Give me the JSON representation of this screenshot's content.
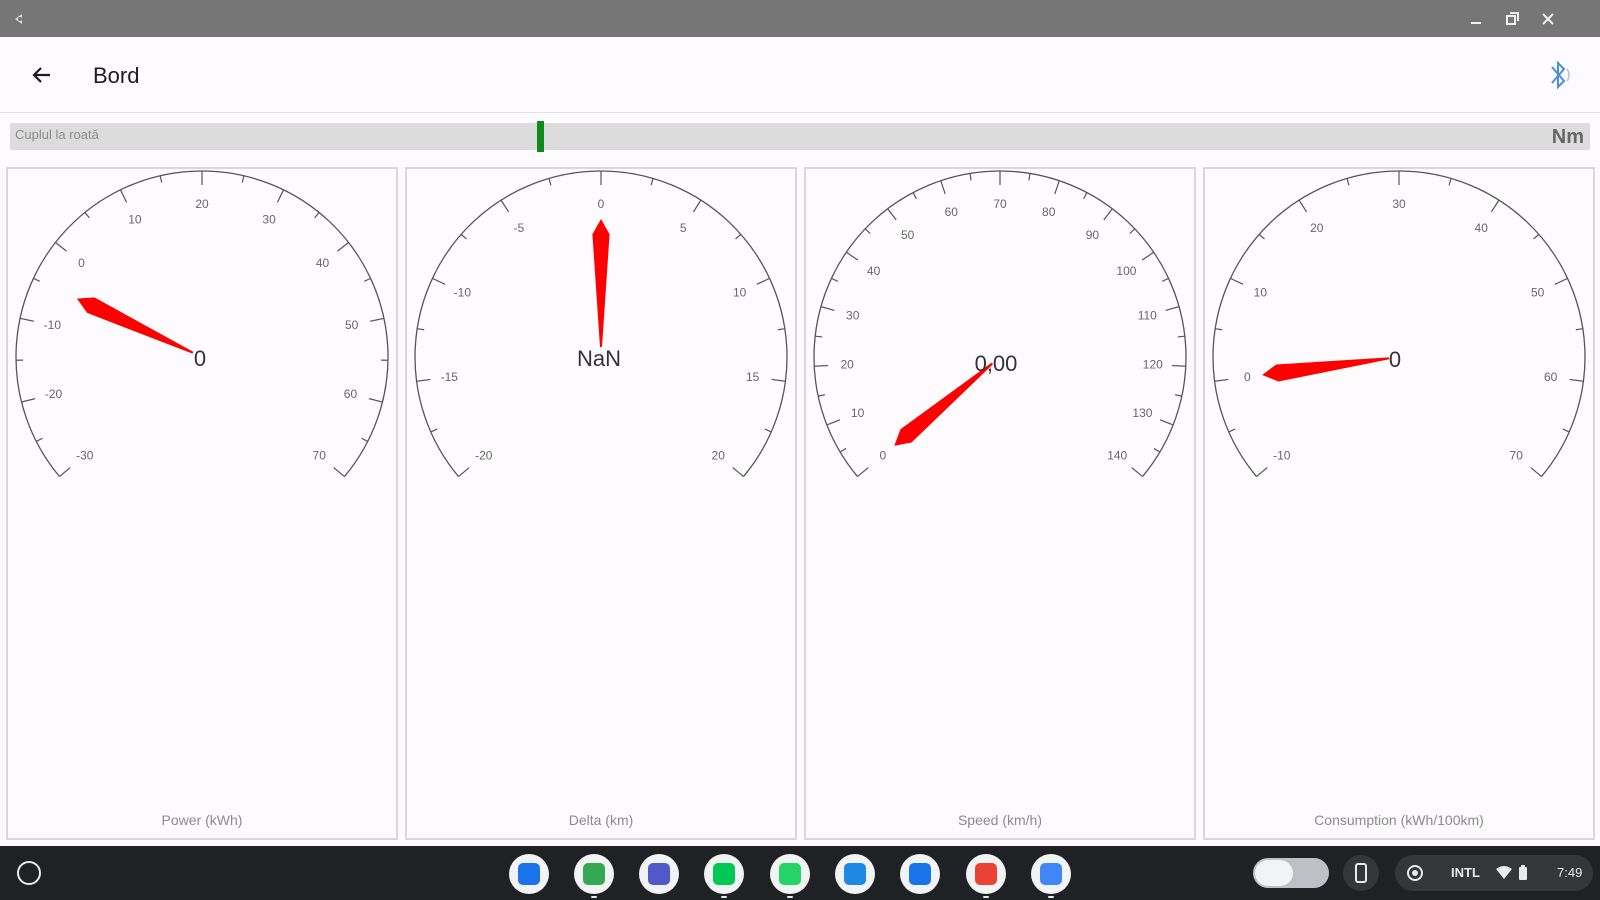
{
  "header": {
    "title": "Bord"
  },
  "torque": {
    "label": "Cuplul la roată",
    "unit": "Nm"
  },
  "gauges": [
    {
      "caption": "Power (kWh)",
      "readout": "0",
      "min": -30,
      "max": 70,
      "major_step": 10,
      "value": -5
    },
    {
      "caption": "Delta (km)",
      "readout": "NaN",
      "min": -20,
      "max": 20,
      "major_step": 5,
      "value": 0
    },
    {
      "caption": "Speed (km/h)",
      "readout": "0,00",
      "min": 0,
      "max": 140,
      "major_step": 10,
      "value": 0
    },
    {
      "caption": "Consumption (kWh/100km)",
      "readout": "0",
      "min": -10,
      "max": 70,
      "major_step": 10,
      "value": 0
    }
  ],
  "status": {
    "ime": "INTL",
    "time": "7:49"
  },
  "shelf": {
    "apps": [
      {
        "name": "files-app",
        "color": "#1a73e8"
      },
      {
        "name": "chrome-app",
        "color": "#34a853"
      },
      {
        "name": "teams-app",
        "color": "#5059c9"
      },
      {
        "name": "play-store-app",
        "color": "#00c853"
      },
      {
        "name": "whatsapp-app",
        "color": "#25d366"
      },
      {
        "name": "home-app",
        "color": "#1e88e5"
      },
      {
        "name": "messages-app",
        "color": "#1a73e8"
      },
      {
        "name": "gmail-app",
        "color": "#ea4335"
      },
      {
        "name": "docs-app",
        "color": "#4285f4"
      }
    ]
  }
}
